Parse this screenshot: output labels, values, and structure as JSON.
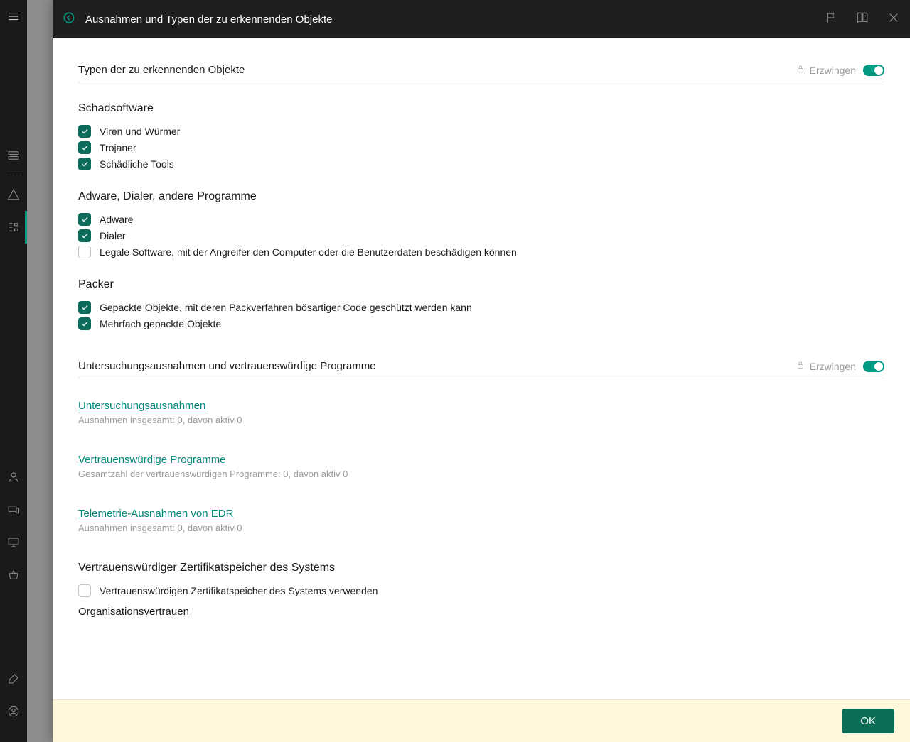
{
  "header": {
    "title": "Ausnahmen und Typen der zu erkennenden Objekte"
  },
  "sections": {
    "types": {
      "title": "Typen der zu erkennenden Objekte",
      "enforce": "Erzwingen"
    },
    "exclusions": {
      "title": "Untersuchungsausnahmen und vertrauenswürdige Programme",
      "enforce": "Erzwingen"
    }
  },
  "groups": {
    "malware": {
      "title": "Schadsoftware",
      "items": [
        {
          "label": "Viren und Würmer",
          "checked": true
        },
        {
          "label": "Trojaner",
          "checked": true
        },
        {
          "label": "Schädliche Tools",
          "checked": true
        }
      ]
    },
    "adware": {
      "title": "Adware, Dialer, andere Programme",
      "items": [
        {
          "label": "Adware",
          "checked": true
        },
        {
          "label": "Dialer",
          "checked": true
        },
        {
          "label": "Legale Software, mit der Angreifer den Computer oder die Benutzerdaten beschädigen können",
          "checked": false
        }
      ]
    },
    "packer": {
      "title": "Packer",
      "items": [
        {
          "label": "Gepackte Objekte, mit deren Packverfahren bösartiger Code geschützt werden kann",
          "checked": true
        },
        {
          "label": "Mehrfach gepackte Objekte",
          "checked": true
        }
      ]
    }
  },
  "links": {
    "scan_exclusions": {
      "label": "Untersuchungsausnahmen",
      "sub": "Ausnahmen insgesamt: 0, davon aktiv 0"
    },
    "trusted_apps": {
      "label": "Vertrauenswürdige Programme",
      "sub": "Gesamtzahl der vertrauenswürdigen Programme: 0, davon aktiv 0"
    },
    "edr": {
      "label": "Telemetrie-Ausnahmen von EDR",
      "sub": "Ausnahmen insgesamt: 0, davon aktiv 0"
    }
  },
  "cert": {
    "heading": "Vertrauenswürdiger Zertifikatspeicher des Systems",
    "checkbox": "Vertrauenswürdigen Zertifikatspeicher des Systems verwenden",
    "org_trust": "Organisationsvertrauen"
  },
  "footer": {
    "ok": "OK"
  }
}
